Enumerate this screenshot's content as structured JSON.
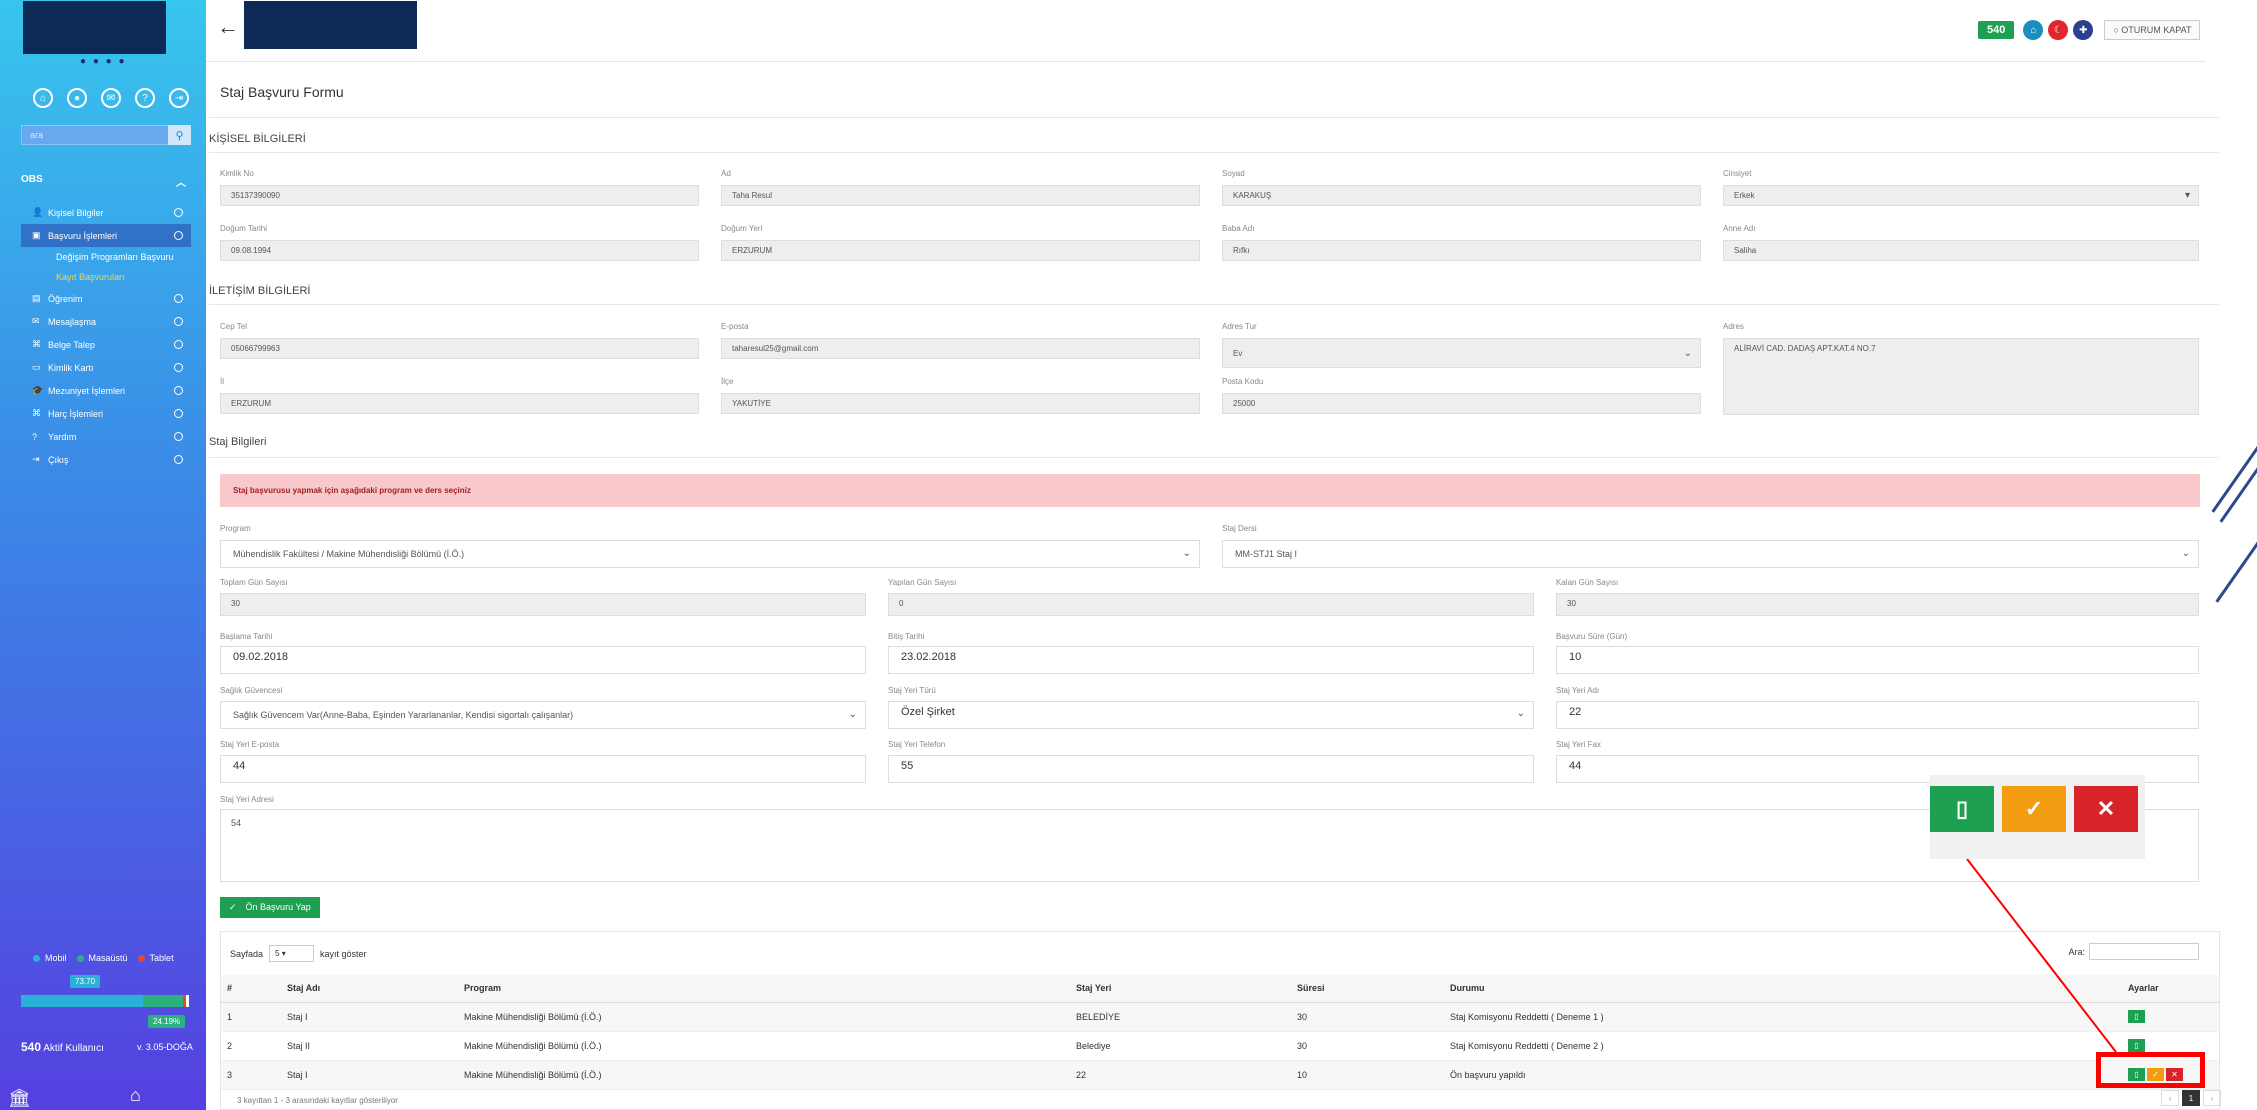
{
  "sidebar": {
    "search_placeholder": "ara",
    "section_title": "OBS",
    "items": [
      {
        "icon": "user-icon",
        "label": "Kişisel Bilgiler"
      },
      {
        "icon": "briefcase-icon",
        "label": "Başvuru İşlemleri"
      },
      {
        "icon": "book-icon",
        "label": "Öğrenim"
      },
      {
        "icon": "mail-icon",
        "label": "Mesajlaşma"
      },
      {
        "icon": "sitemap-icon",
        "label": "Belge Talep"
      },
      {
        "icon": "id-card-icon",
        "label": "Kimlik Kartı"
      },
      {
        "icon": "graduation-cap-icon",
        "label": "Mezuniyet İşlemleri"
      },
      {
        "icon": "sitemap-icon",
        "label": "Harç İşlemleri"
      },
      {
        "icon": "help-icon",
        "label": "Yardım"
      },
      {
        "icon": "sign-out-icon",
        "label": "Çıkış"
      }
    ],
    "sub_items": [
      "Değişim Programları Başvuru",
      "Kayıt Başvuruları"
    ],
    "legend": [
      "Mobil",
      "Masaüstü",
      "Tablet"
    ],
    "legend_colors": [
      "#2bb0d9",
      "#2bb07f",
      "#e8443a"
    ],
    "usage_desktop_label": "73.70",
    "usage_tablet_label": "24.19%",
    "usage_desktop": 0.737,
    "usage_tablet": 0.2419,
    "active_count": "540",
    "active_label": "Aktif Kullanıcı",
    "version": "v. 3.05-DOĞA"
  },
  "topbar": {
    "count_badge": "540",
    "logout_label": "OTURUM KAPAT"
  },
  "form": {
    "title": "Staj Başvuru Formu",
    "personal_section": "KİŞİSEL BİLGİLERİ",
    "personal": {
      "tc_label": "Kimlik No",
      "tc_value": "35137390090",
      "name_label": "Ad",
      "name_value": "Taha Resul",
      "surname_label": "Soyad",
      "surname_value": "KARAKUŞ",
      "gender_label": "Cinsiyet",
      "gender_value": "Erkek",
      "birthdate_label": "Doğum Tarihi",
      "birthdate_value": "09.08.1994",
      "birthplace_label": "Doğum Yeri",
      "birthplace_value": "ERZURUM",
      "father_label": "Baba Adı",
      "father_value": "Rıfkı",
      "mother_label": "Anne Adı",
      "mother_value": "Saliha"
    },
    "contact_section": "İLETİŞİM BİLGİLERİ",
    "contact": {
      "phone_label": "Cep Tel",
      "phone_value": "05066799963",
      "email_label": "E-posta",
      "email_value": "taharesul25@gmail.com",
      "addr_type_label": "Adres Tur",
      "addr_type_value": "Ev",
      "address_label": "Adres",
      "address_value": "ALİRAVİ CAD. DADAŞ APT.KAT.4 NO.7",
      "city_label": "İl",
      "city_value": "ERZURUM",
      "district_label": "İlçe",
      "district_value": "YAKUTİYE",
      "zip_label": "Posta Kodu",
      "zip_value": "25000"
    },
    "internship_section": "Staj Bilgileri",
    "alert": "Staj başvurusu yapmak için aşağıdaki program ve ders seçiniz",
    "internship": {
      "program_label": "Program",
      "program_value": "Mühendislik Fakültesi / Makine Mühendisliği Bölümü (İ.Ö.)",
      "course_label": "Staj Dersi",
      "course_value": "MM-STJ1 Staj I",
      "total_days_label": "Toplam Gün Sayısı",
      "total_days_value": "30",
      "done_days_label": "Yapılan Gün Sayısı",
      "done_days_value": "0",
      "left_days_label": "Kalan Gün Sayısı",
      "left_days_value": "30",
      "start_label": "Başlama Tarihi",
      "start_value": "09.02.2018",
      "end_label": "Bitiş Tarihi",
      "end_value": "23.02.2018",
      "duration_label": "Başvuru Süre (Gün)",
      "duration_value": "10",
      "insurance_label": "Sağlık Güvencesi",
      "insurance_value": "Sağlık Güvencem Var(Anne-Baba, Eşinden Yararlananlar, Kendisi sigortalı çalışanlar)",
      "place_type_label": "Staj Yeri Türü",
      "place_type_value": "Özel Şirket",
      "place_name_label": "Staj Yeri Adı",
      "place_name_value": "22",
      "place_email_label": "Staj Yeri E-posta",
      "place_email_value": "44",
      "place_phone_label": "Staj Yeri Telefon",
      "place_phone_value": "55",
      "place_fax_label": "Staj Yeri Fax",
      "place_fax_value": "44",
      "place_addr_label": "Staj Yeri Adresi",
      "place_addr_value": "54"
    },
    "apply_button": "Ön Başvuru Yap"
  },
  "table": {
    "show_prefix": "Sayfada",
    "page_length": "5",
    "show_suffix": "kayıt göster",
    "search_label": "Ara:",
    "columns": [
      "#",
      "Staj Adı",
      "Program",
      "Staj Yeri",
      "Süresi",
      "Durumu",
      "Ayarlar"
    ],
    "rows": [
      [
        "1",
        "Staj I",
        "Makine Mühendisliği Bölümü (İ.Ö.)",
        "BELEDİYE",
        "30",
        "Staj Komisyonu Reddetti ( Deneme 1 )"
      ],
      [
        "2",
        "Staj II",
        "Makine Mühendisliği Bölümü (İ.Ö.)",
        "Belediye",
        "30",
        "Staj Komisyonu Reddetti ( Deneme 2 )"
      ],
      [
        "3",
        "Staj I",
        "Makine Mühendisliği Bölümü (İ.Ö.)",
        "22",
        "10",
        "Ön başvuru yapıldı"
      ]
    ],
    "footer": "3 kayıttan 1 - 3 arasındaki kayıtlar gösteriliyor",
    "pager": [
      "‹",
      "1",
      "›"
    ]
  },
  "colors": {
    "accent_green": "#1da052",
    "accent_orange": "#f39c12",
    "accent_red": "#d8232a",
    "highlight": "#ff0000"
  }
}
